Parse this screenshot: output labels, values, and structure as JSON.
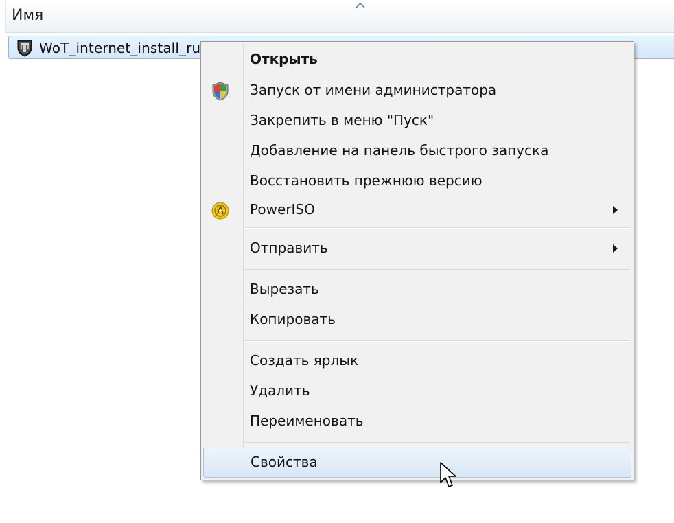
{
  "header": {
    "column_name": "Имя",
    "sort_icon": "sort-ascending-chevron-icon"
  },
  "file": {
    "name": "WoT_internet_install_ru",
    "icon": "world-of-tanks-app-icon",
    "selected": true
  },
  "context_menu": {
    "items": [
      {
        "label": "Открыть",
        "bold": true
      },
      {
        "label": "Запуск от имени администратора",
        "icon": "uac-shield-icon"
      },
      {
        "label": "Закрепить в меню \"Пуск\""
      },
      {
        "label": "Добавление на панель быстрого запуска"
      },
      {
        "label": "Восстановить прежнюю версию"
      },
      {
        "label": "PowerISO",
        "icon": "poweriso-icon",
        "submenu": true
      },
      {
        "label": "Отправить",
        "submenu": true
      },
      {
        "label": "Вырезать"
      },
      {
        "label": "Копировать"
      },
      {
        "label": "Создать ярлык"
      },
      {
        "label": "Удалить"
      },
      {
        "label": "Переименовать"
      },
      {
        "label": "Свойства",
        "highlighted": true
      }
    ]
  },
  "colors": {
    "selection_border": "#8ab9e6",
    "menu_background": "#f1f1f1",
    "hover_border": "#a9c6e2"
  }
}
